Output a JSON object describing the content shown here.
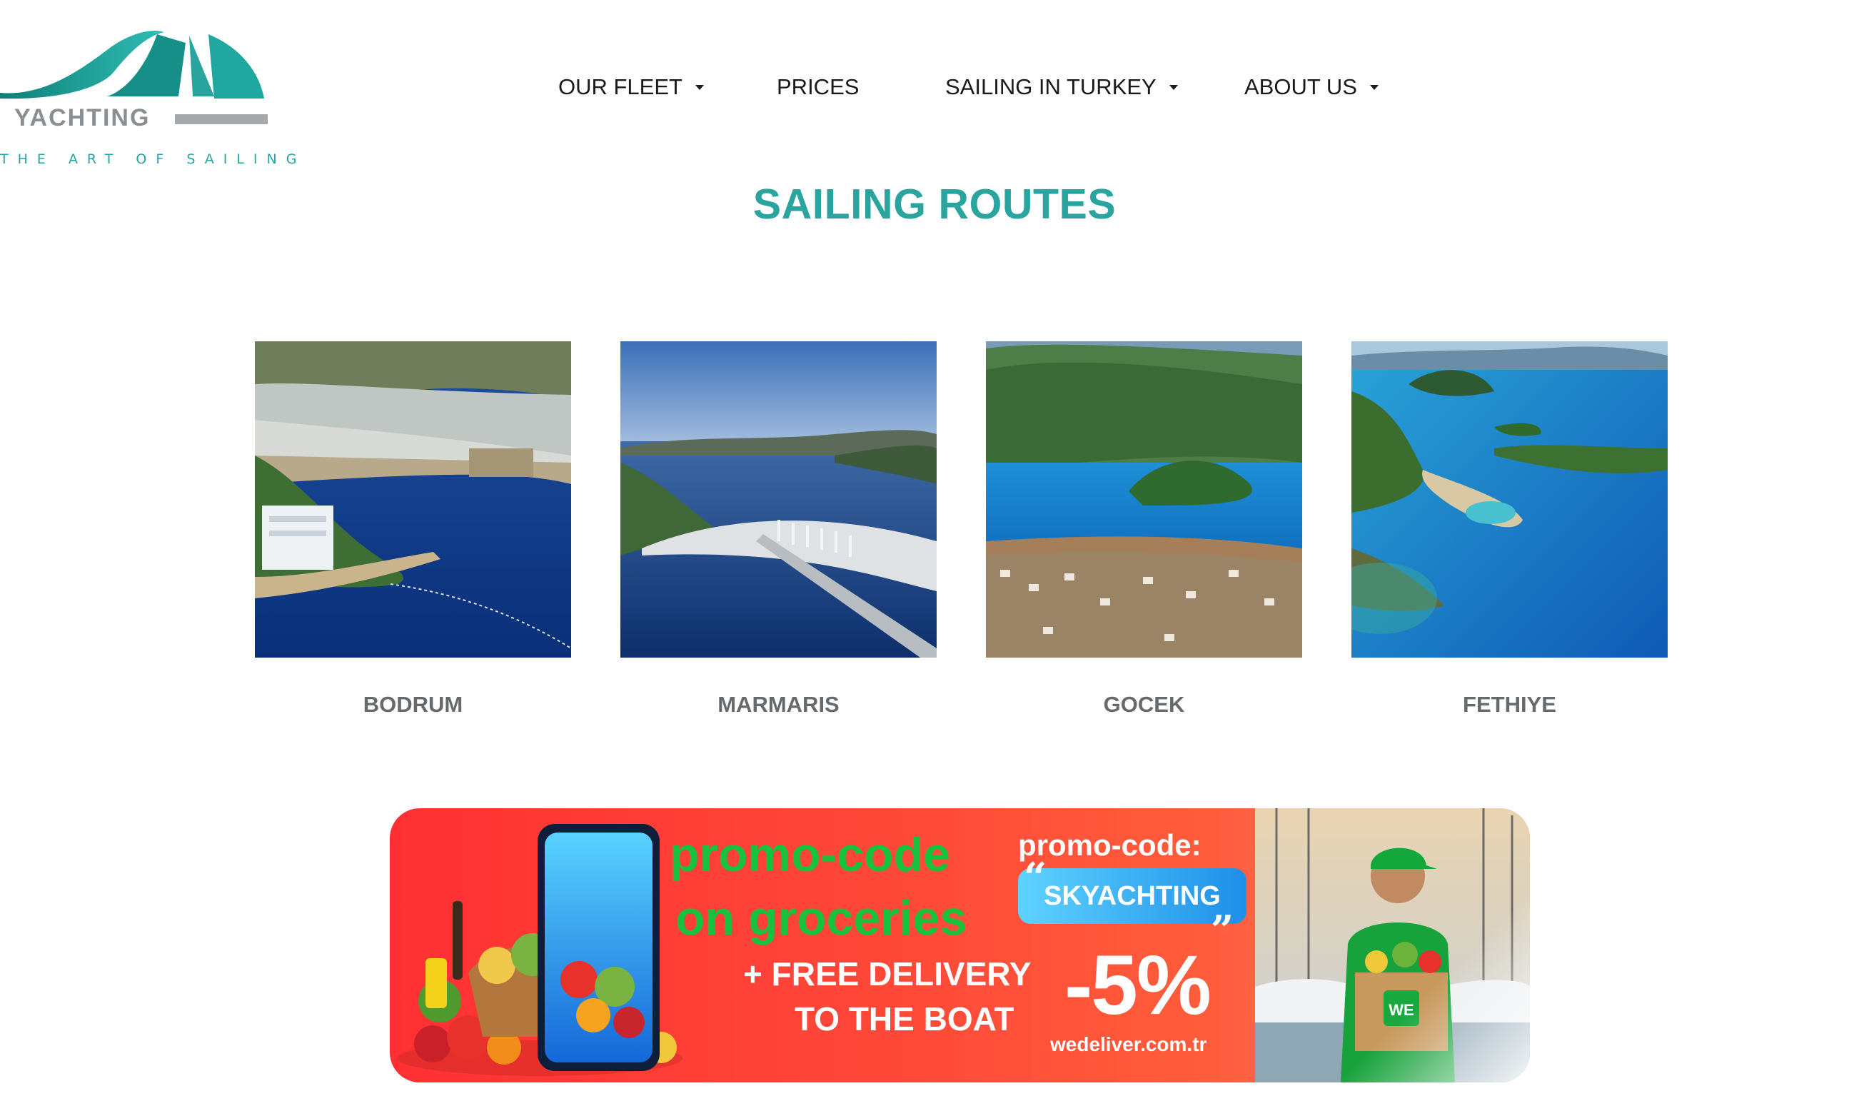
{
  "logo": {
    "wordmark": "YACHTING",
    "tagline": "THE ART OF SAILING",
    "colors": {
      "teal": "#1f9e97",
      "gray": "#8a8f93"
    }
  },
  "nav": {
    "items": [
      {
        "label": "OUR FLEET",
        "has_dropdown": true
      },
      {
        "label": "PRICES",
        "has_dropdown": false
      },
      {
        "label": "SAILING IN TURKEY",
        "has_dropdown": true
      },
      {
        "label": "ABOUT US",
        "has_dropdown": true
      }
    ]
  },
  "section": {
    "title": "SAILING ROUTES"
  },
  "routes": [
    {
      "label": "BODRUM"
    },
    {
      "label": "MARMARIS"
    },
    {
      "label": "GOCEK"
    },
    {
      "label": "FETHIYE"
    }
  ],
  "banner": {
    "headline_line1": "promo-code",
    "headline_line2": "on groceries",
    "promo_label": "promo-code:",
    "promo_code": "SKYACHTING",
    "delivery_line1": "+ FREE DELIVERY",
    "delivery_line2": "TO THE BOAT",
    "discount": "-5%",
    "website": "wedeliver.com.tr",
    "box_logo": "WE",
    "colors": {
      "bg": "#ff3a36",
      "green": "#16c23e",
      "code_bg": "#3bb6f4"
    }
  },
  "colors": {
    "accent": "#2aa49e",
    "label": "#666a6d"
  }
}
